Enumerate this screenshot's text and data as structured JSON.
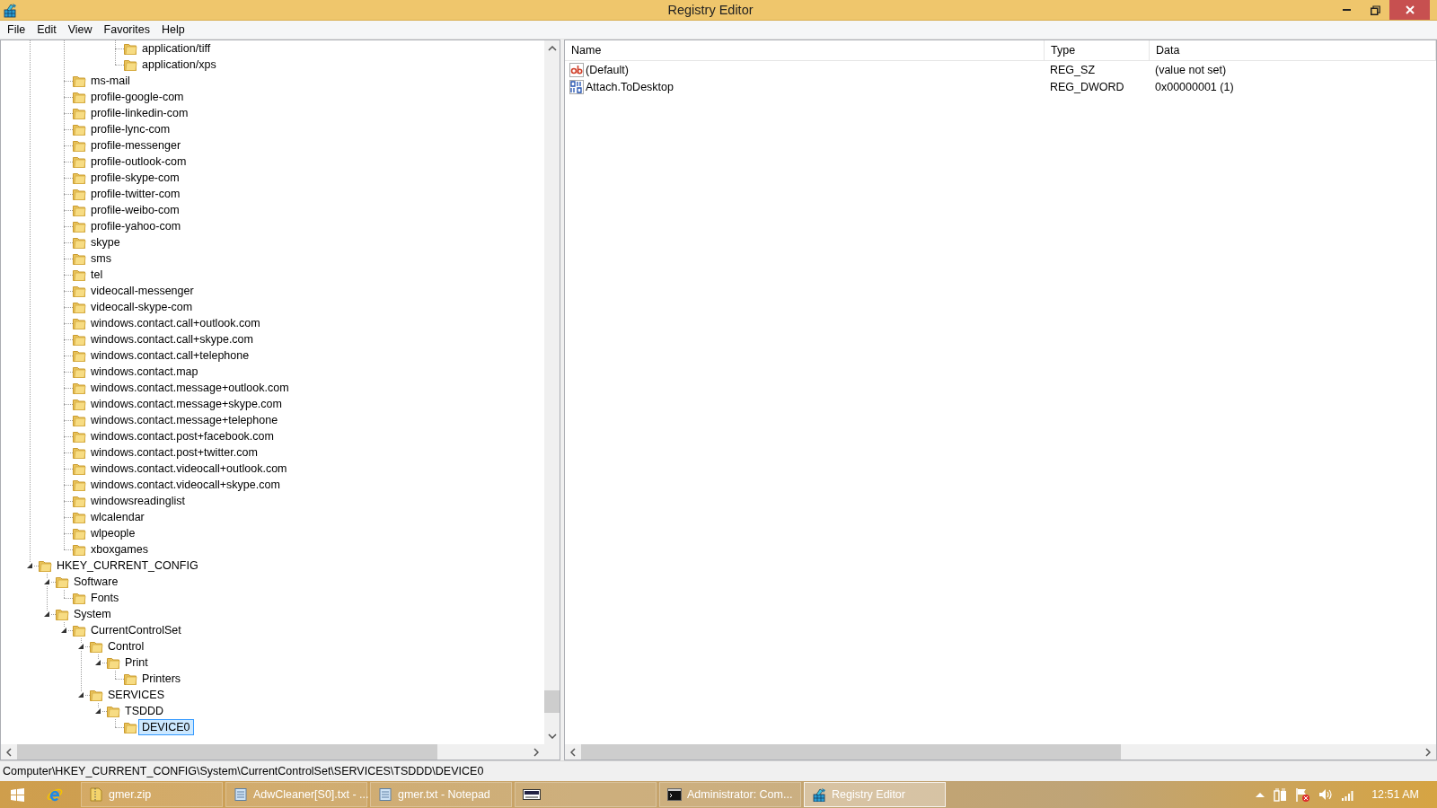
{
  "window": {
    "title": "Registry Editor"
  },
  "menu": [
    "File",
    "Edit",
    "View",
    "Favorites",
    "Help"
  ],
  "tree": [
    {
      "children": [
        {
          "children": [
            {
              "children": [
                {
                  "children": [
                    {
                      "children": [
                        {
                          "label": "application/tiff",
                          "selected": false
                        },
                        {
                          "label": "application/xps",
                          "selected": false
                        }
                      ]
                    }
                  ]
                }
              ]
            },
            {
              "label": "ms-mail",
              "selected": false
            },
            {
              "label": "profile-google-com",
              "selected": false
            },
            {
              "label": "profile-linkedin-com",
              "selected": false
            },
            {
              "label": "profile-lync-com",
              "selected": false
            },
            {
              "label": "profile-messenger",
              "selected": false
            },
            {
              "label": "profile-outlook-com",
              "selected": false
            },
            {
              "label": "profile-skype-com",
              "selected": false
            },
            {
              "label": "profile-twitter-com",
              "selected": false
            },
            {
              "label": "profile-weibo-com",
              "selected": false
            },
            {
              "label": "profile-yahoo-com",
              "selected": false
            },
            {
              "label": "skype",
              "selected": false
            },
            {
              "label": "sms",
              "selected": false
            },
            {
              "label": "tel",
              "selected": false
            },
            {
              "label": "videocall-messenger",
              "selected": false
            },
            {
              "label": "videocall-skype-com",
              "selected": false
            },
            {
              "label": "windows.contact.call+outlook.com",
              "selected": false
            },
            {
              "label": "windows.contact.call+skype.com",
              "selected": false
            },
            {
              "label": "windows.contact.call+telephone",
              "selected": false
            },
            {
              "label": "windows.contact.map",
              "selected": false
            },
            {
              "label": "windows.contact.message+outlook.com",
              "selected": false
            },
            {
              "label": "windows.contact.message+skype.com",
              "selected": false
            },
            {
              "label": "windows.contact.message+telephone",
              "selected": false
            },
            {
              "label": "windows.contact.post+facebook.com",
              "selected": false
            },
            {
              "label": "windows.contact.post+twitter.com",
              "selected": false
            },
            {
              "label": "windows.contact.videocall+outlook.com",
              "selected": false
            },
            {
              "label": "windows.contact.videocall+skype.com",
              "selected": false
            },
            {
              "label": "windowsreadinglist",
              "selected": false
            },
            {
              "label": "wlcalendar",
              "selected": false
            },
            {
              "label": "wlpeople",
              "selected": false
            },
            {
              "label": "xboxgames",
              "selected": false
            }
          ]
        }
      ]
    },
    {
      "label": "HKEY_CURRENT_CONFIG",
      "selected": false,
      "expanded": true,
      "children": [
        {
          "label": "Software",
          "selected": false,
          "expanded": true,
          "children": [
            {
              "label": "Fonts",
              "selected": false
            }
          ]
        },
        {
          "label": "System",
          "selected": false,
          "expanded": true,
          "children": [
            {
              "label": "CurrentControlSet",
              "selected": false,
              "expanded": true,
              "children": [
                {
                  "label": "Control",
                  "selected": false,
                  "expanded": true,
                  "children": [
                    {
                      "label": "Print",
                      "selected": false,
                      "expanded": true,
                      "children": [
                        {
                          "label": "Printers",
                          "selected": false
                        }
                      ]
                    }
                  ]
                },
                {
                  "label": "SERVICES",
                  "selected": false,
                  "expanded": true,
                  "children": [
                    {
                      "label": "TSDDD",
                      "selected": false,
                      "expanded": true,
                      "children": [
                        {
                          "label": "DEVICE0",
                          "selected": true
                        }
                      ]
                    }
                  ]
                }
              ]
            }
          ]
        }
      ]
    }
  ],
  "values": {
    "columns": [
      "Name",
      "Type",
      "Data"
    ],
    "rows": [
      {
        "kind": "string",
        "name": "(Default)",
        "type": "REG_SZ",
        "data": "(value not set)"
      },
      {
        "kind": "binary",
        "name": "Attach.ToDesktop",
        "type": "REG_DWORD",
        "data": "0x00000001 (1)"
      }
    ]
  },
  "status_bar": "Computer\\HKEY_CURRENT_CONFIG\\System\\CurrentControlSet\\SERVICES\\TSDDD\\DEVICE0",
  "taskbar": {
    "buttons": [
      {
        "kind": "zip",
        "label": "gmer.zip",
        "active": false
      },
      {
        "kind": "notepad",
        "label": "AdwCleaner[S0].txt - ...",
        "active": false
      },
      {
        "kind": "notepad",
        "label": "gmer.txt - Notepad",
        "active": false
      },
      {
        "kind": "app",
        "active": false
      },
      {
        "kind": "console",
        "label": "Administrator: Com...",
        "active": false
      },
      {
        "kind": "regedit",
        "label": "Registry Editor",
        "active": true
      }
    ],
    "clock": "12:51 AM"
  }
}
